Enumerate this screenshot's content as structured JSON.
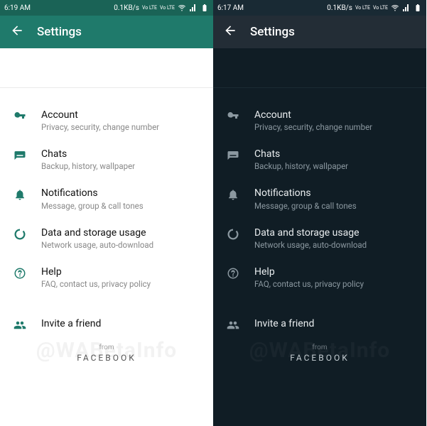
{
  "left": {
    "status": {
      "time": "6:19 AM",
      "speed": "0.1KB/s",
      "volte1": "Vo LTE",
      "volte2": "Vo LTE"
    },
    "appbar": {
      "title": "Settings"
    },
    "items": [
      {
        "name": "account",
        "title": "Account",
        "sub": "Privacy, security, change number"
      },
      {
        "name": "chats",
        "title": "Chats",
        "sub": "Backup, history, wallpaper"
      },
      {
        "name": "notifications",
        "title": "Notifications",
        "sub": "Message, group & call tones"
      },
      {
        "name": "data",
        "title": "Data and storage usage",
        "sub": "Network usage, auto-download"
      },
      {
        "name": "help",
        "title": "Help",
        "sub": "FAQ, contact us, privacy policy"
      }
    ],
    "invite": {
      "title": "Invite a friend"
    },
    "footer": {
      "from": "from",
      "brand": "FACEBOOK"
    }
  },
  "right": {
    "status": {
      "time": "6:17 AM",
      "speed": "0.1KB/s",
      "volte1": "Vo LTE",
      "volte2": "Vo LTE"
    },
    "appbar": {
      "title": "Settings"
    },
    "items": [
      {
        "name": "account",
        "title": "Account",
        "sub": "Privacy, security, change number"
      },
      {
        "name": "chats",
        "title": "Chats",
        "sub": "Backup, history, wallpaper"
      },
      {
        "name": "notifications",
        "title": "Notifications",
        "sub": "Message, group & call tones"
      },
      {
        "name": "data",
        "title": "Data and storage usage",
        "sub": "Network usage, auto-download"
      },
      {
        "name": "help",
        "title": "Help",
        "sub": "FAQ, contact us, privacy policy"
      }
    ],
    "invite": {
      "title": "Invite a friend"
    },
    "footer": {
      "from": "from",
      "brand": "FACEBOOK"
    }
  },
  "watermark": "@WABetaInfo"
}
